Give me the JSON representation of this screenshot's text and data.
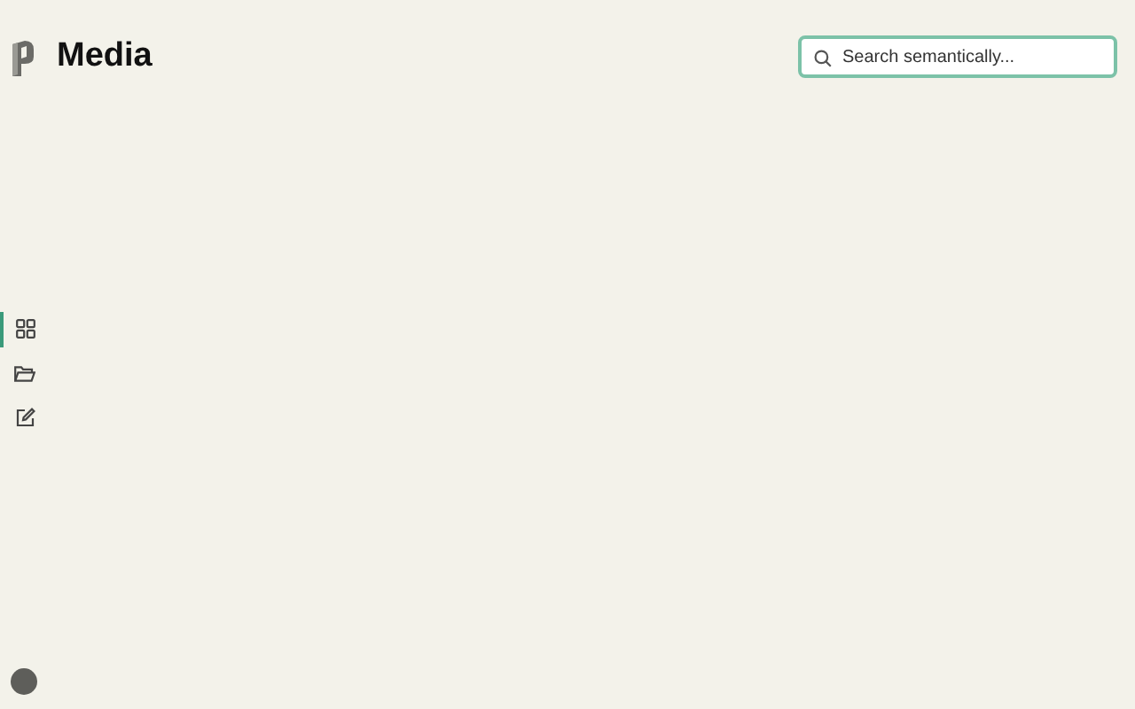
{
  "header": {
    "title": "Media"
  },
  "search": {
    "placeholder": "Search semantically..."
  },
  "sidebar": {
    "items": [
      {
        "kind": "grid",
        "selected": true
      },
      {
        "kind": "folder",
        "selected": false
      },
      {
        "kind": "edit",
        "selected": false
      }
    ]
  }
}
